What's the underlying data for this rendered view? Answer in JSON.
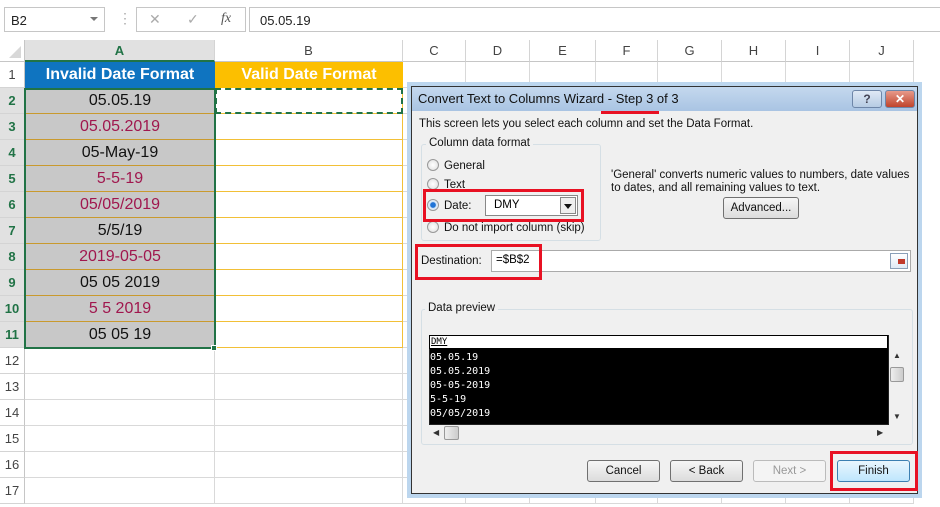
{
  "formula_bar": {
    "name_box": "B2",
    "cancel_icon": "✕",
    "enter_icon": "✓",
    "fx_label": "fx",
    "formula": "05.05.19"
  },
  "columns": [
    "A",
    "B",
    "C",
    "D",
    "E",
    "F",
    "G",
    "H",
    "I",
    "J"
  ],
  "rows": [
    "1",
    "2",
    "3",
    "4",
    "5",
    "6",
    "7",
    "8",
    "9",
    "10",
    "11",
    "12",
    "13",
    "14",
    "15",
    "16",
    "17"
  ],
  "sheet": {
    "header_a": "Invalid Date Format",
    "header_b": "Valid Date Format",
    "colors": {
      "header_a_bg": "#0f74c0",
      "header_b_bg": "#fcbf00",
      "data_bg": "#c8c8c8",
      "red_text": "#a0174e",
      "selection": "#217346"
    },
    "values": [
      {
        "text": "05.05.19",
        "red": false
      },
      {
        "text": "05.05.2019",
        "red": true
      },
      {
        "text": "05-May-19",
        "red": false
      },
      {
        "text": "5-5-19",
        "red": true
      },
      {
        "text": "05/05/2019",
        "red": true
      },
      {
        "text": "5/5/19",
        "red": false
      },
      {
        "text": "2019-05-05",
        "red": true
      },
      {
        "text": "05 05 2019",
        "red": false
      },
      {
        "text": "5 5 2019",
        "red": true
      },
      {
        "text": "05 05 19",
        "red": false
      }
    ]
  },
  "dialog": {
    "title_prefix": "Convert Text to Columns Wizard - ",
    "title_step": "Step 3 of 3",
    "help_label": "?",
    "close_label": "✕",
    "description": "This screen lets you select each column and set the Data Format.",
    "group_title": "Column data format",
    "radio_general": "General",
    "radio_text": "Text",
    "radio_date": "Date:",
    "radio_skip": "Do not import column (skip)",
    "selected_radio": "Date",
    "date_format": "DMY",
    "general_note": "'General' converts numeric values to numbers, date values to dates, and all remaining values to text.",
    "advanced_label": "Advanced...",
    "destination_label": "Destination:",
    "destination_value": "=$B$2",
    "preview_title": "Data preview",
    "preview_header": "DMY",
    "preview_lines": [
      "05.05.19",
      "05.05.2019",
      "05-05-2019",
      "5-5-19",
      "05/05/2019"
    ],
    "cancel_label": "Cancel",
    "back_label": "< Back",
    "next_label": "Next >",
    "finish_label": "Finish",
    "highlight_color": "#e81123"
  }
}
